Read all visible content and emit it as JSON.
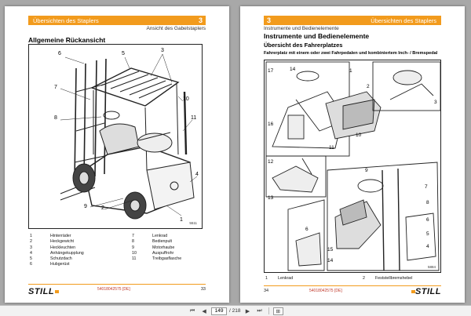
{
  "left_page": {
    "header_title": "Übersichten des Staplers",
    "chapter": "3",
    "header_sub": "Ansicht des Gabelstaplers",
    "section_title": "Allgemeine Rückansicht",
    "figure_code": "5511",
    "callouts": [
      "1",
      "2",
      "3",
      "4",
      "5",
      "6",
      "7",
      "8",
      "9",
      "10",
      "11",
      "3"
    ],
    "legend_left": [
      {
        "num": "1",
        "label": "Hinterräder"
      },
      {
        "num": "2",
        "label": "Heckgewicht"
      },
      {
        "num": "3",
        "label": "Heckleuchten"
      },
      {
        "num": "4",
        "label": "Anhängekupplung"
      },
      {
        "num": "5",
        "label": "Schutzdach"
      },
      {
        "num": "6",
        "label": "Hubgerüst"
      }
    ],
    "legend_right": [
      {
        "num": "7",
        "label": "Lenkrad"
      },
      {
        "num": "8",
        "label": "Bedienpult"
      },
      {
        "num": "9",
        "label": "Motorhaube"
      },
      {
        "num": "10",
        "label": "Auspuffrohr"
      },
      {
        "num": "11",
        "label": "Treibgasflasche"
      }
    ],
    "footer_doc": "54018042575 [DE]",
    "page_number": "33",
    "logo": "STILL"
  },
  "right_page": {
    "chapter": "3",
    "header_title": "Übersichten des Staplers",
    "header_sub": "Instrumente und Bedienelemente",
    "section_title": "Instrumente und Bedienelemente",
    "section_subtitle": "Übersicht des Fahrerplatzes",
    "figure_caption": "Fahrerplatz mit einem oder zwei Fahrpedalen und kombiniertem Inch- / Bremspedal",
    "figure_code": "5884",
    "callouts": [
      "1",
      "2",
      "3",
      "4",
      "5",
      "6",
      "7",
      "8",
      "9",
      "10",
      "11",
      "12",
      "13",
      "14",
      "15",
      "16",
      "17"
    ],
    "legend": [
      {
        "num": "1",
        "label": "Lenkrad"
      },
      {
        "num": "2",
        "label": "Feststellbremshebel"
      }
    ],
    "footer_doc": "54018042575 [DE]",
    "page_number": "34",
    "logo": "STILL"
  },
  "toolbar": {
    "current_page": "149",
    "total_pages": "/ 218",
    "zoom": "⊞",
    "first_icon": "first-page-icon",
    "prev_icon": "prev-page-icon",
    "next_icon": "next-page-icon",
    "last_icon": "last-page-icon"
  },
  "colors": {
    "accent": "#f29b1d",
    "background": "#a8a8a8",
    "doc_red": "#c0392b"
  }
}
